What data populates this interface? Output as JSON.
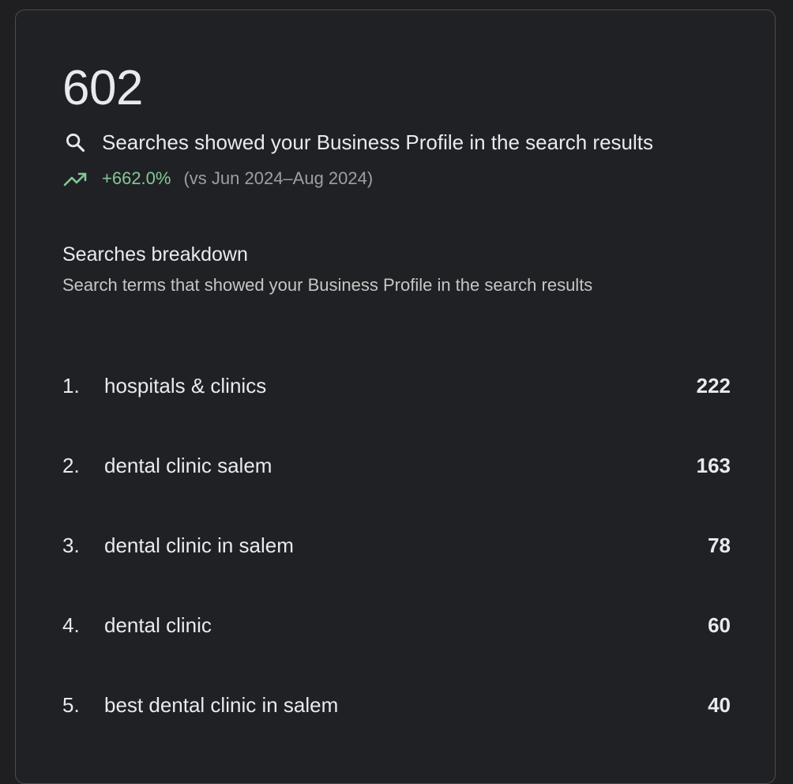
{
  "summary": {
    "total": "602",
    "description": "Searches showed your Business Profile in the search results",
    "search_icon": "search-icon",
    "trend_icon": "trending-up-icon",
    "change_value": "+662.0%",
    "change_compare": "(vs Jun 2024–Aug 2024)",
    "change_color": "#81c995"
  },
  "breakdown": {
    "title": "Searches breakdown",
    "description": "Search terms that showed your Business Profile in the search results",
    "items": [
      {
        "rank": "1.",
        "term": "hospitals & clinics",
        "count": "222"
      },
      {
        "rank": "2.",
        "term": "dental clinic salem",
        "count": "163"
      },
      {
        "rank": "3.",
        "term": "dental clinic in salem",
        "count": "78"
      },
      {
        "rank": "4.",
        "term": "dental clinic",
        "count": "60"
      },
      {
        "rank": "5.",
        "term": "best dental clinic in salem",
        "count": "40"
      }
    ]
  }
}
